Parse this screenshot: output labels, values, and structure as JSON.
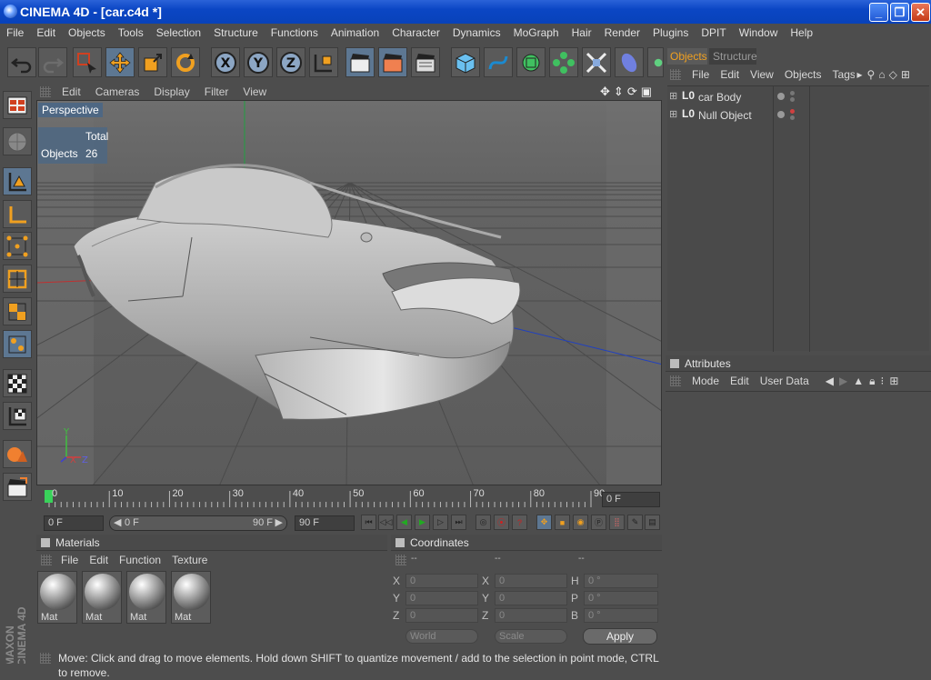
{
  "window": {
    "title": "CINEMA 4D - [car.c4d *]"
  },
  "menu": [
    "File",
    "Edit",
    "Objects",
    "Tools",
    "Selection",
    "Structure",
    "Functions",
    "Animation",
    "Character",
    "Dynamics",
    "MoGraph",
    "Hair",
    "Render",
    "Plugins",
    "DPIT",
    "Window",
    "Help"
  ],
  "viewport": {
    "menu": [
      "Edit",
      "Cameras",
      "Display",
      "Filter",
      "View"
    ],
    "label": "Perspective",
    "hud": {
      "col_header": "Total",
      "row_label": "Objects",
      "row_value": "26"
    }
  },
  "timeline": {
    "ticks": [
      "0",
      "10",
      "20",
      "30",
      "40",
      "50",
      "60",
      "70",
      "80",
      "90"
    ],
    "current_frame": "0 F",
    "start_frame": "0 F",
    "range_start": "0 F",
    "range_end": "90 F",
    "end_frame": "90 F"
  },
  "objects_panel": {
    "tabs": [
      "Objects",
      "Structure"
    ],
    "menu": [
      "File",
      "Edit",
      "View",
      "Objects",
      "Tags"
    ],
    "items": [
      {
        "name": "car Body"
      },
      {
        "name": "Null Object"
      }
    ]
  },
  "attributes_panel": {
    "title": "Attributes",
    "menu": [
      "Mode",
      "Edit",
      "User Data"
    ]
  },
  "materials_panel": {
    "title": "Materials",
    "menu": [
      "File",
      "Edit",
      "Function",
      "Texture"
    ],
    "materials": [
      {
        "name": "Mat"
      },
      {
        "name": "Mat"
      },
      {
        "name": "Mat"
      },
      {
        "name": "Mat"
      }
    ]
  },
  "coordinates_panel": {
    "title": "Coordinates",
    "col_headers": [
      "--",
      "--",
      "--"
    ],
    "rows": [
      {
        "l1": "X",
        "v1": "0",
        "l2": "X",
        "v2": "0",
        "l3": "H",
        "v3": "0 °"
      },
      {
        "l1": "Y",
        "v1": "0",
        "l2": "Y",
        "v2": "0",
        "l3": "P",
        "v3": "0 °"
      },
      {
        "l1": "Z",
        "v1": "0",
        "l2": "Z",
        "v2": "0",
        "l3": "B",
        "v3": "0 °"
      }
    ],
    "mode_select": "World",
    "scale_select": "Scale",
    "apply_label": "Apply"
  },
  "sidebar_logo": {
    "line1": "MAXON",
    "line2": "CINEMA 4D"
  },
  "status": "Move: Click and drag to move elements. Hold down SHIFT to quantize movement / add to the selection in point mode, CTRL to remove.",
  "colors": {
    "accent_blue": "#5d7792",
    "highlight_orange": "#e0a030",
    "bg": "#4d4d4d"
  }
}
